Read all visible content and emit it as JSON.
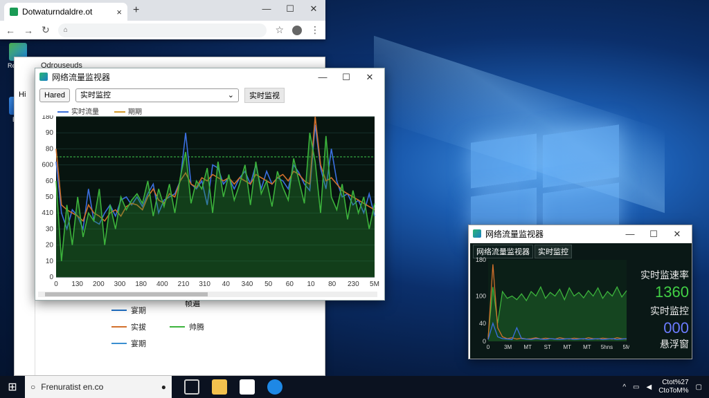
{
  "desktop": {
    "icons": [
      {
        "label": "Recyce"
      },
      {
        "label": "Beo"
      }
    ]
  },
  "browser": {
    "tab_title": "Dotwaturndaldre.ot",
    "close": "×",
    "new_tab": "+",
    "minimize": "—",
    "maximize": "☐",
    "close_win": "✕",
    "back": "←",
    "forward": "→",
    "reload": "↻",
    "home": "⌂",
    "star": "☆",
    "menu": "⋮"
  },
  "bg_window": {
    "title": "Odrouseuds",
    "tab_stub": "Hi",
    "legend": [
      {
        "label": "宴期",
        "color": "#1f6fc4"
      },
      {
        "label": "实拔",
        "color": "#d2702b"
      },
      {
        "label": "宴期",
        "color": "#3a8fd0"
      }
    ],
    "legend_extra": {
      "label": "帅腾",
      "color": "#3cb33c"
    },
    "top_label": "帧遍"
  },
  "main_window": {
    "title": "网络流量监视器",
    "btn_left": "Hared",
    "select_value": "实时监控",
    "action_btn": "实时监视",
    "legend": [
      {
        "label": "实时流量",
        "color": "#3a6fd8"
      },
      {
        "label": "期期",
        "color": "#d29a2b"
      }
    ]
  },
  "chart_data": {
    "type": "line",
    "title": "",
    "xlabel": "",
    "ylabel": "",
    "ylim": [
      0,
      100
    ],
    "x_ticks": [
      "0",
      "130",
      "200",
      "300",
      "180",
      "400",
      "210",
      "310",
      "40",
      "340",
      "50",
      "60",
      "10",
      "80",
      "230",
      "5M"
    ],
    "y_ticks": [
      "0",
      "10",
      "20",
      "30",
      "40",
      "50",
      "60",
      "70",
      "80",
      "90",
      "100"
    ],
    "y_ticks_display": [
      "0",
      "10",
      "20",
      "30",
      "410",
      "50",
      "60",
      "600",
      "80",
      "90",
      "180"
    ],
    "reference_line": 75,
    "series": [
      {
        "color": "#3b6fe0",
        "values": [
          72,
          40,
          30,
          42,
          38,
          30,
          55,
          35,
          33,
          40,
          45,
          38,
          48,
          50,
          45,
          50,
          44,
          52,
          58,
          40,
          48,
          50,
          52,
          60,
          90,
          58,
          55,
          60,
          45,
          70,
          68,
          58,
          62,
          55,
          62,
          66,
          58,
          70,
          55,
          66,
          58,
          62,
          60,
          55,
          70,
          65,
          58,
          54,
          95,
          68,
          55,
          80,
          60,
          50,
          52,
          45,
          48,
          40,
          52,
          38
        ]
      },
      {
        "color": "#d2702b",
        "values": [
          80,
          45,
          42,
          40,
          38,
          35,
          45,
          40,
          38,
          35,
          40,
          42,
          38,
          44,
          46,
          45,
          42,
          50,
          55,
          48,
          46,
          52,
          50,
          60,
          65,
          58,
          56,
          62,
          60,
          64,
          62,
          60,
          62,
          58,
          62,
          60,
          58,
          64,
          62,
          60,
          58,
          62,
          64,
          60,
          66,
          64,
          60,
          58,
          105,
          70,
          60,
          62,
          58,
          54,
          52,
          50,
          48,
          46,
          44,
          42
        ]
      },
      {
        "color": "#3cb33c",
        "values": [
          60,
          10,
          45,
          20,
          50,
          25,
          40,
          35,
          55,
          20,
          45,
          30,
          50,
          42,
          48,
          52,
          46,
          60,
          38,
          55,
          44,
          58,
          40,
          62,
          78,
          46,
          60,
          55,
          68,
          40,
          72,
          50,
          64,
          48,
          58,
          70,
          45,
          72,
          52,
          60,
          44,
          66,
          56,
          48,
          74,
          60,
          46,
          90,
          72,
          40,
          88,
          50,
          42,
          58,
          36,
          54,
          40,
          50,
          30,
          46
        ]
      }
    ]
  },
  "float_window": {
    "title": "网络流量监视器",
    "tabs": [
      "网络流量监视器",
      "实时监控"
    ],
    "y_ticks": [
      "0",
      "40",
      "100",
      "180"
    ],
    "x_ticks": [
      "0",
      "3M",
      "MT",
      "ST",
      "MT",
      "MT",
      "5hns",
      "5M"
    ],
    "stat1_label": "实时监速率",
    "stat1_value": "1360",
    "stat2_label": "实时监控",
    "stat2_value": "000",
    "footer": "悬浮窗"
  },
  "float_chart": {
    "type": "line",
    "ylim": [
      0,
      180
    ],
    "series": [
      {
        "color": "#3cb33c",
        "values": [
          10,
          120,
          40,
          110,
          95,
          100,
          92,
          105,
          90,
          110,
          100,
          120,
          95,
          108,
          100,
          115,
          92,
          118,
          100,
          108,
          96,
          112,
          100,
          118,
          95,
          110,
          100,
          120,
          98,
          112
        ]
      },
      {
        "color": "#d2702b",
        "values": [
          5,
          170,
          30,
          10,
          6,
          8,
          5,
          7,
          5,
          6,
          8,
          5,
          7,
          6,
          5,
          8,
          6,
          5,
          7,
          6,
          5,
          8,
          6,
          5,
          7,
          6,
          5,
          8,
          6,
          5
        ]
      },
      {
        "color": "#3b6fe0",
        "values": [
          4,
          40,
          10,
          6,
          5,
          4,
          30,
          6,
          5,
          4,
          6,
          5,
          4,
          6,
          5,
          4,
          5,
          6,
          4,
          5,
          6,
          4,
          5,
          6,
          4,
          5,
          6,
          4,
          5,
          6
        ]
      }
    ]
  },
  "taskbar": {
    "start": "⊞",
    "search_text": "Frenuratist en.co",
    "mic": "🎤",
    "time": "Ctot%27",
    "date": "CtoToM%",
    "tray_up": "^",
    "notif": "🗨"
  }
}
